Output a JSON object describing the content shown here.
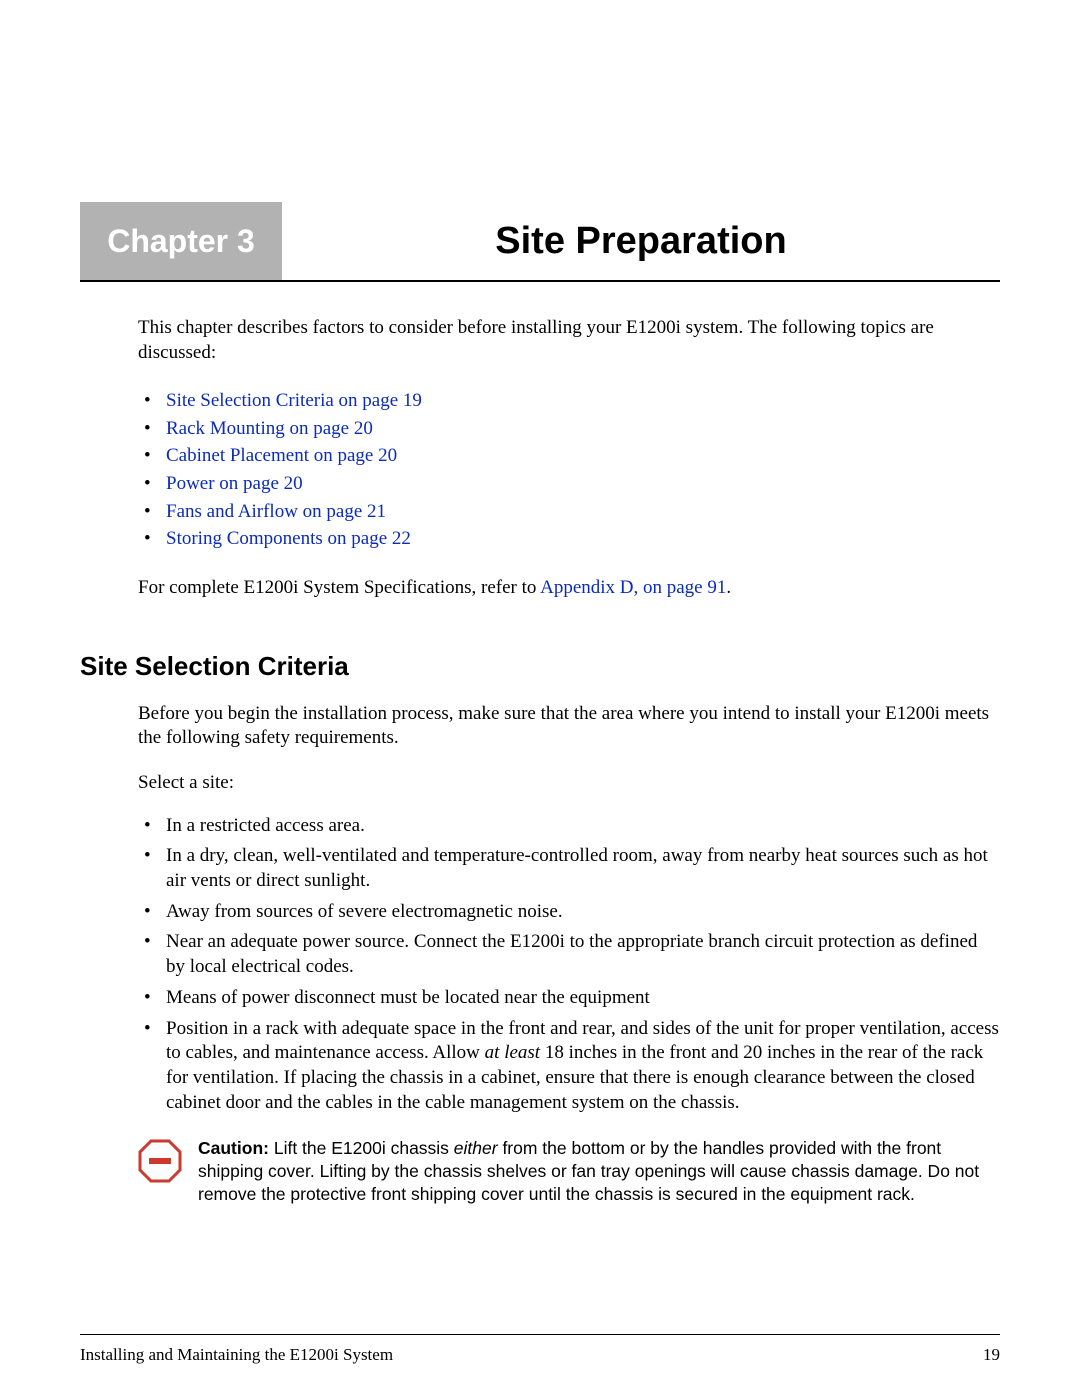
{
  "chapter": {
    "label": "Chapter 3",
    "title": "Site Preparation"
  },
  "intro": "This chapter describes factors to consider before installing your E1200i system. The following topics are discussed:",
  "toc": [
    "Site Selection Criteria on page 19",
    "Rack Mounting on page 20",
    "Cabinet Placement on page 20",
    "Power on page 20",
    "Fans and Airflow on page 21",
    "Storing Components on page 22"
  ],
  "spec_prefix": "For complete E1200i System Specifications, refer to ",
  "spec_link": "Appendix D, on page 91",
  "spec_suffix": ".",
  "section": {
    "heading": "Site Selection Criteria",
    "para1": "Before you begin the installation process, make sure that the area where you intend to install your E1200i meets the following safety requirements.",
    "para2": "Select a site:",
    "bullets": [
      "In a restricted access area.",
      "In a dry, clean, well-ventilated and temperature-controlled room, away from nearby heat sources such as hot air vents or direct sunlight.",
      "Away from sources of severe electromagnetic noise.",
      "Near an adequate power source. Connect the E1200i to the appropriate branch circuit protection as defined by local electrical codes.",
      "Means of power disconnect must be located near the equipment"
    ],
    "bullet6_pre": "Position in a rack with adequate space in the front and rear, and sides of the unit for proper ventilation, access to cables, and maintenance access. Allow ",
    "bullet6_italic": "at least",
    "bullet6_post": " 18 inches in the front and 20 inches in the rear of the rack for ventilation. If placing the chassis in a cabinet, ensure that there is enough clearance between the closed cabinet door and the cables in the cable management system on the chassis."
  },
  "caution": {
    "label": "Caution:",
    "pre": " Lift the E1200i chassis ",
    "italic": "either",
    "post": " from the bottom or by the handles provided with the front shipping cover. Lifting by the chassis shelves or fan tray openings will cause chassis damage. Do not remove the protective front shipping cover until the chassis is secured in the equipment rack."
  },
  "footer": {
    "left": "Installing and Maintaining the E1200i  System",
    "right": "19"
  }
}
